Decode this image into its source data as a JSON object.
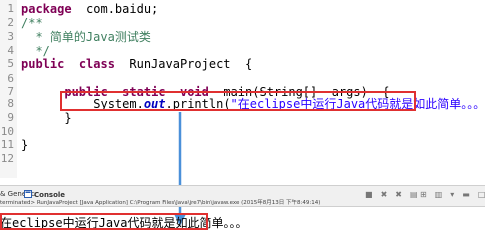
{
  "editor": {
    "lines": [
      {
        "num": "1",
        "parts": [
          [
            "kw",
            "package"
          ],
          [
            "",
            "  com.baidu;"
          ]
        ]
      },
      {
        "num": "2",
        "parts": [
          [
            "cm",
            "/**"
          ]
        ]
      },
      {
        "num": "3",
        "parts": [
          [
            "cm",
            "  * "
          ],
          [
            "cm cjk",
            "简单的"
          ],
          [
            "cm",
            "Java"
          ],
          [
            "cm cjk",
            "测试类"
          ]
        ]
      },
      {
        "num": "4",
        "parts": [
          [
            "cm",
            "  */"
          ]
        ]
      },
      {
        "num": "5",
        "parts": [
          [
            "kw",
            "public"
          ],
          [
            "",
            "  "
          ],
          [
            "kw",
            "class"
          ],
          [
            "",
            "  RunJavaProject  {"
          ]
        ]
      },
      {
        "num": "6",
        "parts": []
      },
      {
        "num": "7",
        "parts": [
          [
            "",
            "      "
          ],
          [
            "kw",
            "public"
          ],
          [
            "",
            "  "
          ],
          [
            "kw",
            "static"
          ],
          [
            "",
            "  "
          ],
          [
            "kw",
            "void"
          ],
          [
            "",
            "  main(String[]  args)  {"
          ]
        ]
      },
      {
        "num": "8",
        "parts": [
          [
            "",
            "          System."
          ],
          [
            "fld",
            "out"
          ],
          [
            "",
            ".println("
          ],
          [
            "str",
            "\"在"
          ],
          [
            "str",
            "eclipse"
          ],
          [
            "str cjk",
            "中运行"
          ],
          [
            "str",
            "Java"
          ],
          [
            "str cjk",
            "代码就是如此简单。。。"
          ],
          [
            "str",
            "\""
          ],
          [
            "",
            ");"
          ]
        ]
      },
      {
        "num": "9",
        "parts": [
          [
            "",
            "      }"
          ]
        ]
      },
      {
        "num": "10",
        "parts": []
      },
      {
        "num": "11",
        "parts": [
          [
            "",
            "}"
          ]
        ]
      },
      {
        "num": "12",
        "parts": []
      }
    ]
  },
  "console": {
    "tab_generic_label": "& Generic",
    "tab_console_label": "Console",
    "status_text": "terminated> RunJavaProject [Java Application] C:\\Program Files\\Java\\jre7\\bin\\javaw.exe (2015年8月13日 下午8:49:14)",
    "output_prefix": "在",
    "output_latin": "eclipse",
    "output_mid": "中运行",
    "output_java": "Java",
    "output_suffix": "代码就是如此简单。。。"
  },
  "colors": {
    "highlight_border": "#e03030",
    "arrow": "#4a90d9"
  },
  "icons": [
    "console-icon",
    "terminate-icon",
    "remove-launch-icon",
    "clear-console-icon",
    "scroll-lock-icon",
    "pin-console-icon",
    "display-selected-icon",
    "open-console-icon",
    "minimize-icon",
    "maximize-icon"
  ]
}
